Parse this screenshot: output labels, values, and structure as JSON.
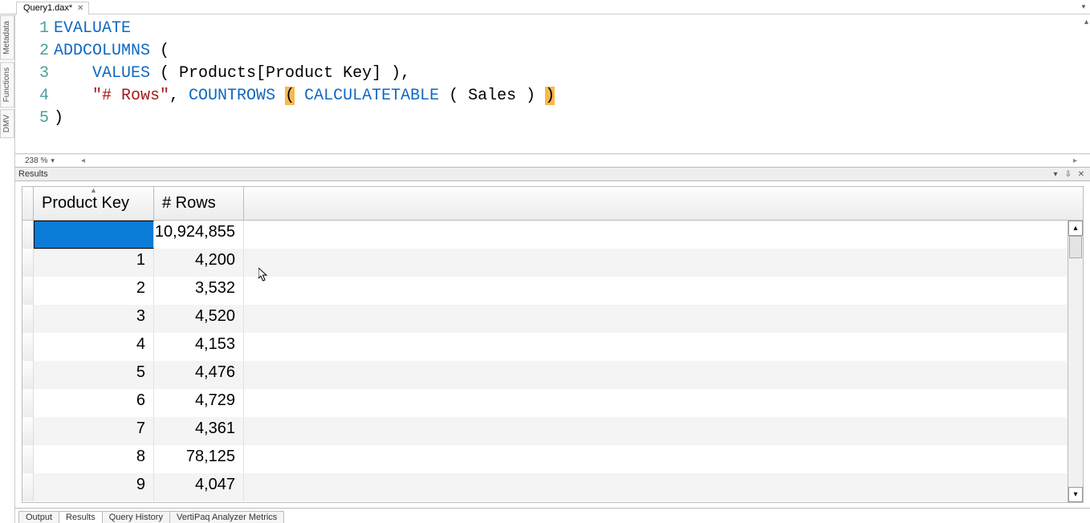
{
  "file_tab": {
    "label": "Query1.dax*",
    "close_title": "Close"
  },
  "side_tabs": [
    "Metadata",
    "Functions",
    "DMV"
  ],
  "editor": {
    "lines": [
      {
        "n": "1",
        "tokens": [
          {
            "t": "EVALUATE",
            "c": "kw-blue"
          }
        ]
      },
      {
        "n": "2",
        "tokens": [
          {
            "t": "ADDCOLUMNS",
            "c": "kw-blue"
          },
          {
            "t": " (",
            "c": "plain"
          }
        ]
      },
      {
        "n": "3",
        "tokens": [
          {
            "t": "    ",
            "c": "plain"
          },
          {
            "t": "VALUES",
            "c": "kw-blue"
          },
          {
            "t": " ( Products[Product Key] ),",
            "c": "plain"
          }
        ]
      },
      {
        "n": "4",
        "tokens": [
          {
            "t": "    ",
            "c": "plain"
          },
          {
            "t": "\"# Rows\"",
            "c": "kw-brown"
          },
          {
            "t": ", ",
            "c": "plain"
          },
          {
            "t": "COUNTROWS",
            "c": "kw-blue"
          },
          {
            "t": " ",
            "c": "plain"
          },
          {
            "t": "(",
            "c": "hl-paren"
          },
          {
            "t": " ",
            "c": "plain"
          },
          {
            "t": "CALCULATETABLE",
            "c": "kw-blue"
          },
          {
            "t": " ( Sales ) ",
            "c": "plain"
          },
          {
            "t": ")",
            "c": "hl-paren"
          }
        ]
      },
      {
        "n": "5",
        "tokens": [
          {
            "t": ")",
            "c": "plain"
          }
        ]
      }
    ],
    "zoom": "238 %"
  },
  "results": {
    "panel_title": "Results",
    "columns": [
      "Product Key",
      "# Rows"
    ],
    "rows": [
      {
        "key": "",
        "rows": "10,924,855",
        "selected": true
      },
      {
        "key": "1",
        "rows": "4,200"
      },
      {
        "key": "2",
        "rows": "3,532"
      },
      {
        "key": "3",
        "rows": "4,520"
      },
      {
        "key": "4",
        "rows": "4,153"
      },
      {
        "key": "5",
        "rows": "4,476"
      },
      {
        "key": "6",
        "rows": "4,729"
      },
      {
        "key": "7",
        "rows": "4,361"
      },
      {
        "key": "8",
        "rows": "78,125"
      },
      {
        "key": "9",
        "rows": "4,047"
      }
    ]
  },
  "bottom_tabs": [
    "Output",
    "Results",
    "Query History",
    "VertiPaq Analyzer Metrics"
  ],
  "bottom_active": 1
}
